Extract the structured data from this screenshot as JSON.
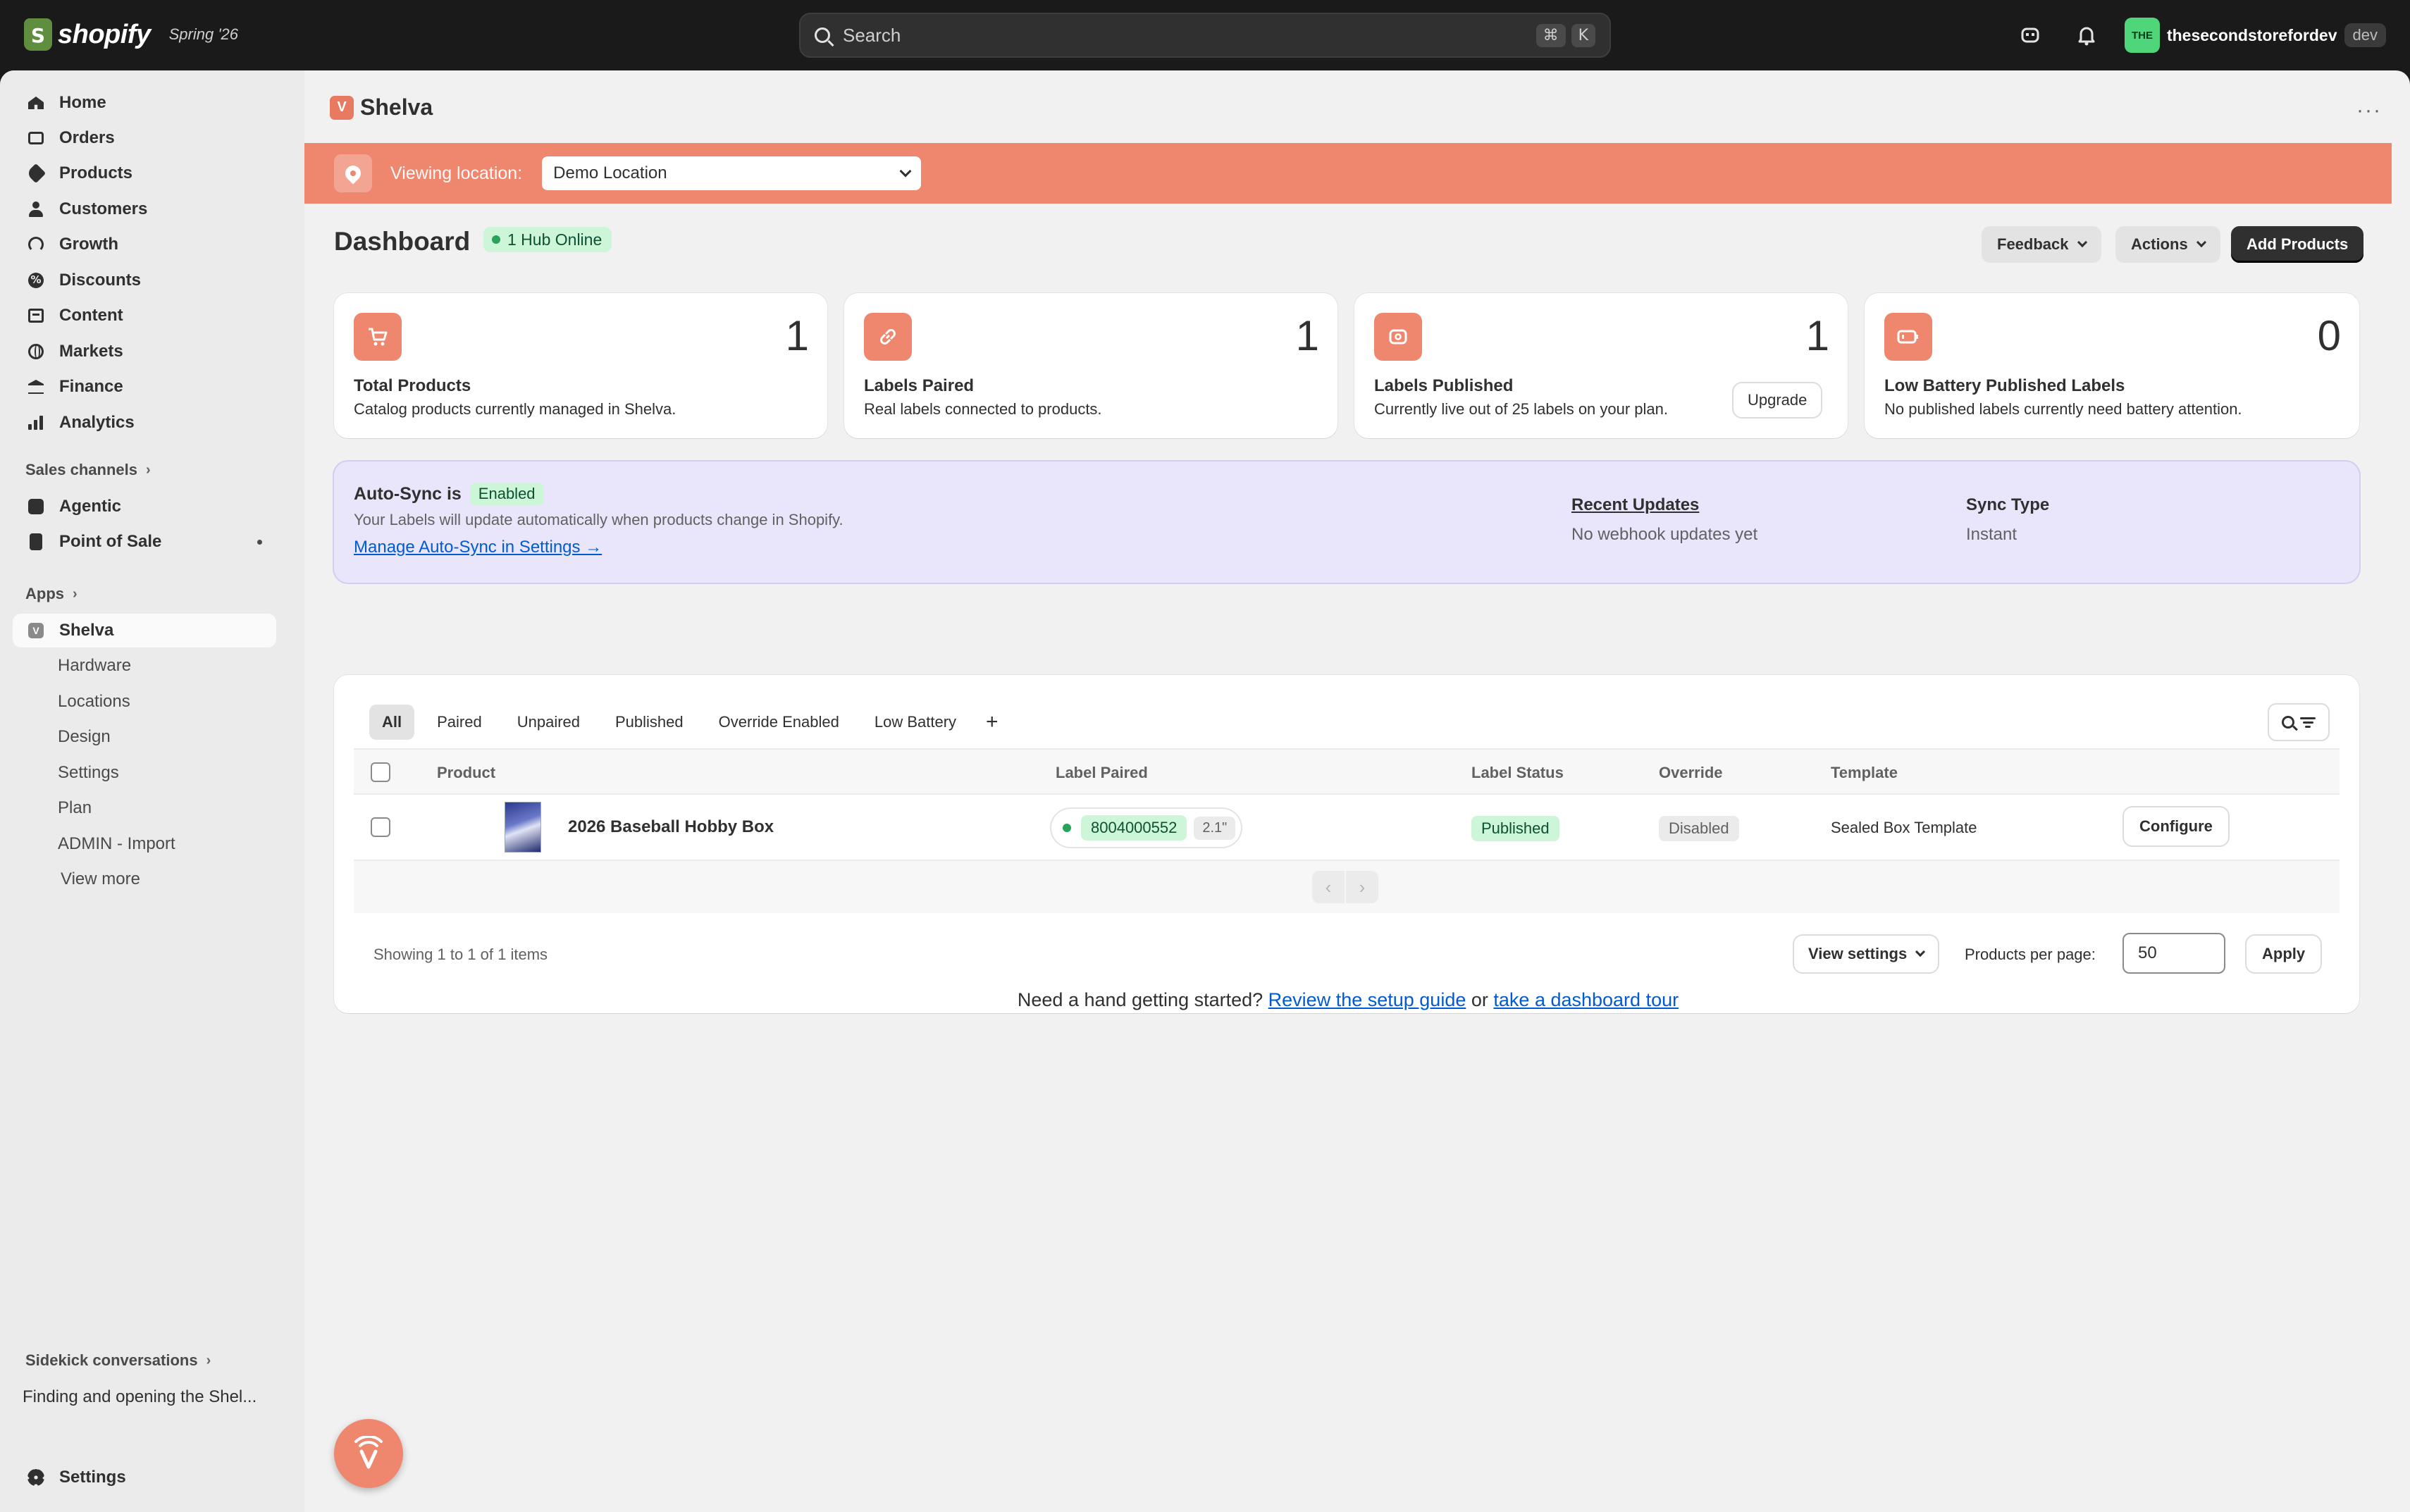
{
  "topbar": {
    "brand": "shopify",
    "edition": "Spring '26",
    "search_placeholder": "Search",
    "shortcut_keys": [
      "⌘",
      "K"
    ],
    "store_initials": "THE",
    "store_name": "thesecondstorefordev",
    "store_tag": "dev"
  },
  "sidebar": {
    "items": [
      {
        "label": "Home",
        "icon": "home-icon"
      },
      {
        "label": "Orders",
        "icon": "orders-icon"
      },
      {
        "label": "Products",
        "icon": "tag-icon"
      },
      {
        "label": "Customers",
        "icon": "person-icon"
      },
      {
        "label": "Growth",
        "icon": "gauge-icon"
      },
      {
        "label": "Discounts",
        "icon": "discount-icon"
      },
      {
        "label": "Content",
        "icon": "content-icon"
      },
      {
        "label": "Markets",
        "icon": "globe-icon"
      },
      {
        "label": "Finance",
        "icon": "bank-icon"
      },
      {
        "label": "Analytics",
        "icon": "bar-chart-icon"
      }
    ],
    "sales_channels_heading": "Sales channels",
    "channels": [
      {
        "label": "Agentic",
        "icon": "agentic-icon"
      },
      {
        "label": "Point of Sale",
        "icon": "pos-icon"
      }
    ],
    "apps_heading": "Apps",
    "app": {
      "label": "Shelva",
      "icon": "shelva-icon"
    },
    "app_subitems": [
      "Hardware",
      "Locations",
      "Design",
      "Settings",
      "Plan",
      "ADMIN - Import"
    ],
    "view_more": "View more",
    "sidekick_heading": "Sidekick conversations",
    "sidekick_item": "Finding and opening the Shel...",
    "settings": "Settings"
  },
  "app_header": {
    "title": "Shelva",
    "more": "···"
  },
  "location_bar": {
    "label": "Viewing location:",
    "selected": "Demo Location"
  },
  "dashboard": {
    "title": "Dashboard",
    "hub_status": "1 Hub Online",
    "buttons": {
      "feedback": "Feedback",
      "actions": "Actions",
      "add_products": "Add Products"
    }
  },
  "stats": [
    {
      "value": "1",
      "title": "Total Products",
      "desc": "Catalog products currently managed in Shelva.",
      "icon": "cart-icon"
    },
    {
      "value": "1",
      "title": "Labels Paired",
      "desc": "Real labels connected to products.",
      "icon": "link-icon"
    },
    {
      "value": "1",
      "title": "Labels Published",
      "desc": "Currently live out of 25 labels on your plan.",
      "icon": "broadcast-icon",
      "action": "Upgrade"
    },
    {
      "value": "0",
      "title": "Low Battery Published Labels",
      "desc": "No published labels currently need battery attention.",
      "icon": "battery-icon"
    }
  ],
  "auto_sync": {
    "title": "Auto-Sync is",
    "status": "Enabled",
    "desc": "Your Labels will update automatically when products change in Shopify.",
    "link": "Manage Auto-Sync in Settings →",
    "recent_updates_title": "Recent Updates",
    "recent_updates_value": "No webhook updates yet",
    "sync_type_title": "Sync Type",
    "sync_type_value": "Instant"
  },
  "table": {
    "tabs": [
      "All",
      "Paired",
      "Unpaired",
      "Published",
      "Override Enabled",
      "Low Battery"
    ],
    "add_tab": "+",
    "columns": [
      "Product",
      "Label Paired",
      "Label Status",
      "Override",
      "Template"
    ],
    "rows": [
      {
        "product": "2026 Baseball Hobby Box",
        "label_id": "8004000552",
        "label_size": "2.1\"",
        "status": "Published",
        "override": "Disabled",
        "template": "Sealed Box Template",
        "action": "Configure"
      }
    ],
    "pager_prev": "‹",
    "pager_next": "›",
    "showing": "Showing 1 to 1 of 1 items",
    "view_settings": "View settings",
    "per_page_label": "Products per page:",
    "per_page_value": "50",
    "apply": "Apply"
  },
  "help": {
    "prefix": "Need a hand getting started?",
    "link1": "Review the setup guide",
    "middle": "or",
    "link2": "take a dashboard tour"
  },
  "colors": {
    "accent": "#ef876f",
    "sync_bg": "#e9e6fb",
    "success_bg": "#cdf5d8",
    "link": "#005bd3"
  }
}
